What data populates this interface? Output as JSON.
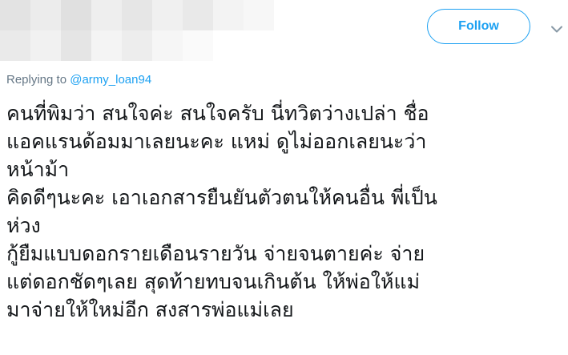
{
  "header": {
    "follow_label": "Follow",
    "caret_icon": "chevron-down-icon",
    "accent_color": "#1da1f2"
  },
  "reply": {
    "prefix": "Replying to",
    "handle": "@army_loan94"
  },
  "tweet": {
    "lines": [
      "คนที่พิมว่า สนใจค่ะ สนใจครับ นี่ทวิตว่างเปล่า ชื่อ",
      "แอคแรนด้อมมาเลยนะคะ แหม่ ดูไม่ออกเลยนะว่า",
      "หน้าม้า",
      "คิดดีๆนะคะ เอาเอกสารยืนยันตัวตนให้คนอื่น พี่เป็น",
      "ห่วง",
      "กู้ยืมแบบดอกรายเดือนรายวัน  จ่ายจนตายค่ะ จ่าย",
      "แต่ดอกชัดๆเลย  สุดท้ายทบจนเกินต้น ให้พ่อให้แม่",
      "มาจ่ายให้ใหม่อีก สงสารพ่อแม่เลย"
    ]
  }
}
